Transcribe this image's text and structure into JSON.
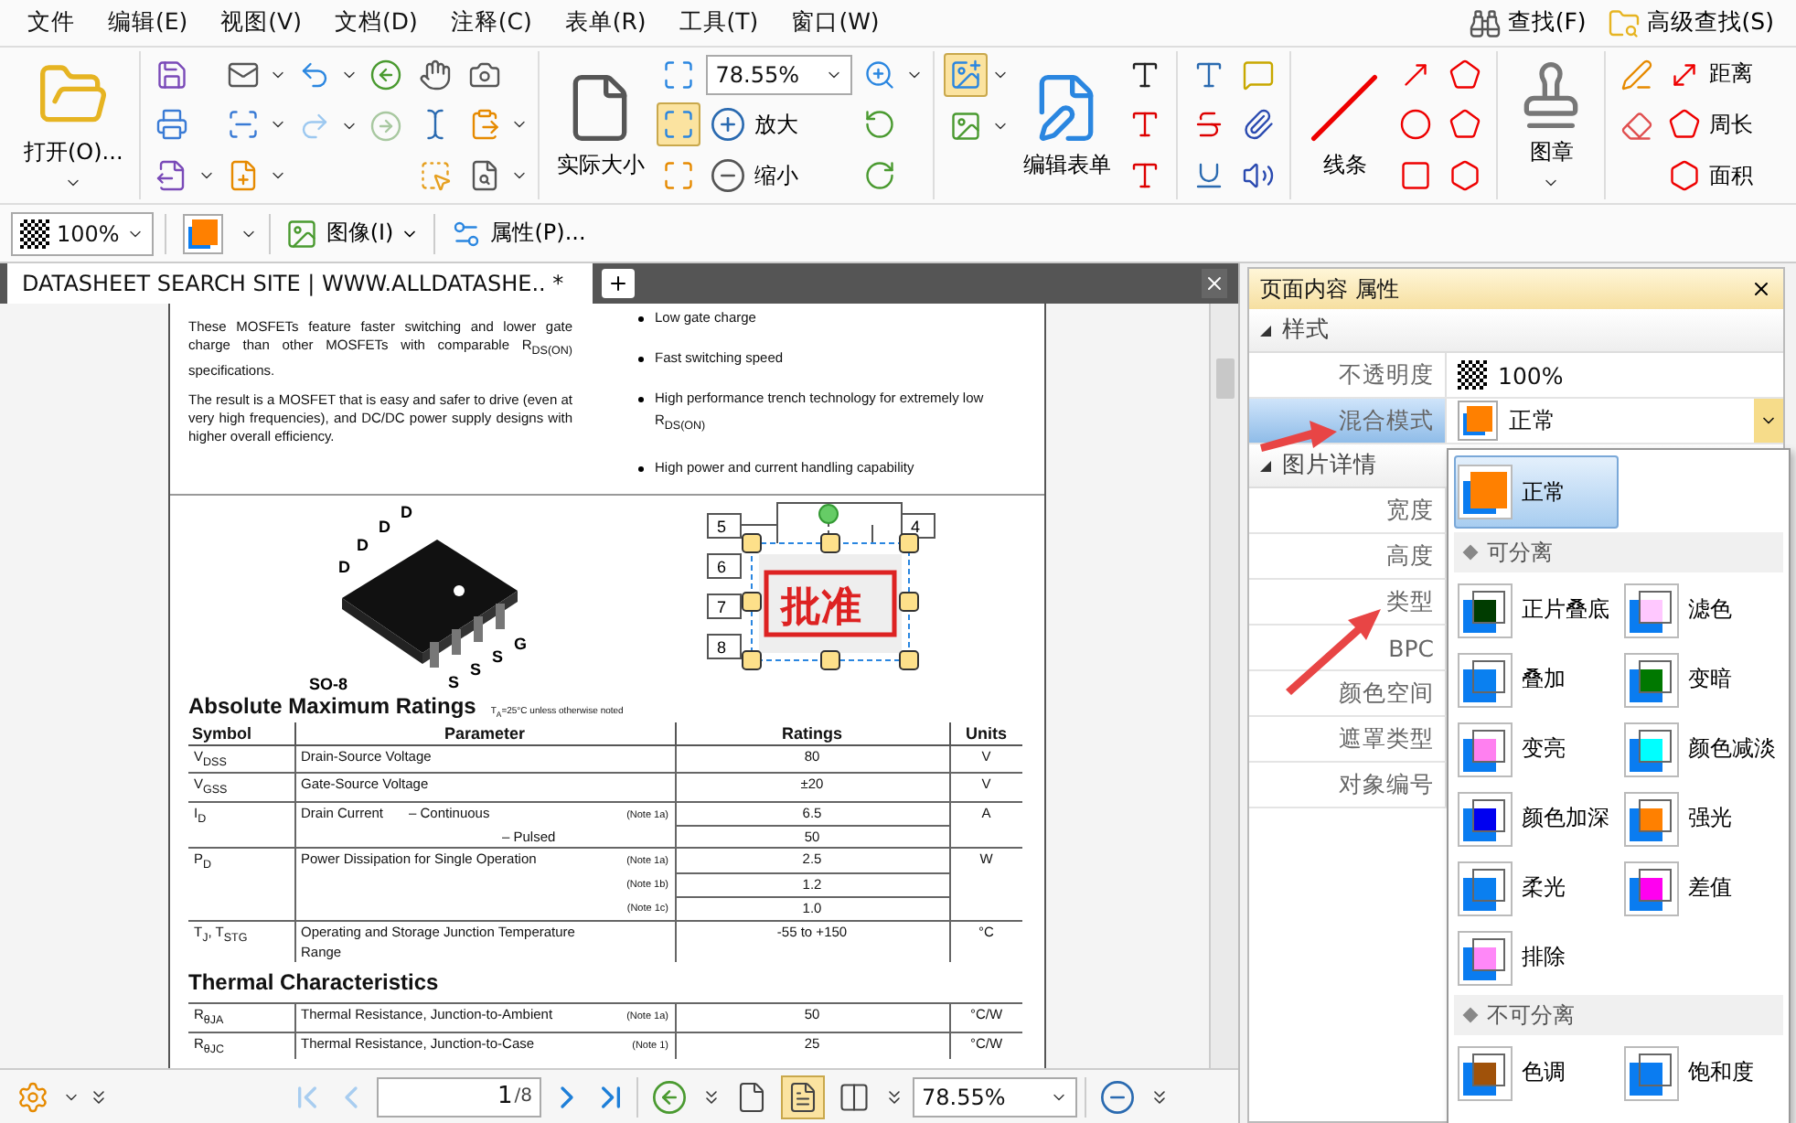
{
  "menu": [
    "文件",
    "编辑(E)",
    "视图(V)",
    "文档(D)",
    "注释(C)",
    "表单(R)",
    "工具(T)",
    "窗口(W)"
  ],
  "search_buttons": [
    "查找(F)",
    "高级查找(S)"
  ],
  "toolbar": {
    "open": "打开(O)...",
    "actual_size": "实际大小",
    "zoom_value": "78.55%",
    "zoom_in": "放大",
    "zoom_out": "缩小",
    "edit_form": "编辑表单",
    "line": "线条",
    "stamp": "图章",
    "distance": "距离",
    "perimeter": "周长",
    "area": "面积",
    "fit_page_selected": true,
    "image_tool_selected": true
  },
  "format_bar": {
    "opacity": "100%",
    "image": "图像(I)",
    "properties": "属性(P)..."
  },
  "tab": {
    "title": "DATASHEET SEARCH SITE | WWW.ALLDATASHE.. *",
    "selected": true
  },
  "document": {
    "description": [
      "These MOSFETs feature faster switching and lower gate charge than other MOSFETs with comparable R$_{DS(ON)}$ specifications.",
      "The result is a MOSFET that is easy and safer to drive (even at very high frequencies), and DC/DC power supply designs with higher overall efficiency."
    ],
    "features": [
      "Low gate charge",
      "Fast switching speed",
      "High performance trench technology for extremely low R$_{DS(ON)}$",
      "High power and current handling capability"
    ],
    "package": {
      "name": "SO-8",
      "pins": [
        "D",
        "D",
        "D",
        "D",
        "G",
        "S",
        "S",
        "S"
      ]
    },
    "pinout": {
      "pins": [
        "5",
        "4",
        "6",
        "7",
        "8"
      ],
      "stamp": "批准",
      "stamp_selected": true
    },
    "ratings": {
      "title": "Absolute Maximum Ratings",
      "note": "T$_{A}$=25°C unless otherwise noted",
      "columns": [
        "Symbol",
        "Parameter",
        "Ratings",
        "Units"
      ],
      "rows": [
        {
          "symbol": "V$_{DSS}$",
          "parameter": "Drain-Source Voltage",
          "lines": [
            {
              "value": "80"
            }
          ],
          "unit": "V"
        },
        {
          "symbol": "V$_{GSS}$",
          "parameter": "Gate-Source Voltage",
          "lines": [
            {
              "value": "±20"
            }
          ],
          "unit": "V"
        },
        {
          "symbol": "I$_{D}$",
          "parameter": "Drain Current",
          "lines": [
            {
              "label": "– Continuous",
              "note": "(Note 1a)",
              "value": "6.5"
            },
            {
              "label": "– Pulsed",
              "value": "50"
            }
          ],
          "unit": "A"
        },
        {
          "symbol": "P$_{D}$",
          "parameter": "Power Dissipation for Single Operation",
          "lines": [
            {
              "note": "(Note 1a)",
              "value": "2.5"
            },
            {
              "note": "(Note 1b)",
              "value": "1.2"
            },
            {
              "note": "(Note 1c)",
              "value": "1.0"
            }
          ],
          "unit": "W"
        },
        {
          "symbol": "T$_{J}$, T$_{STG}$",
          "parameter": "Operating and Storage Junction Temperature Range",
          "lines": [
            {
              "value": "-55 to +150"
            }
          ],
          "unit": "°C"
        }
      ]
    },
    "thermal": {
      "title": "Thermal Characteristics",
      "rows": [
        {
          "symbol": "R$_{θJA}$",
          "parameter": "Thermal Resistance, Junction-to-Ambient",
          "lines": [
            {
              "note": "(Note 1a)",
              "value": "50"
            }
          ],
          "unit": "°C/W"
        },
        {
          "symbol": "R$_{θJC}$",
          "parameter": "Thermal Resistance, Junction-to-Case",
          "lines": [
            {
              "note": "(Note 1)",
              "value": "25"
            }
          ],
          "unit": "°C/W"
        }
      ]
    }
  },
  "navigation": {
    "buttons": [
      {
        "kind": "first",
        "disabled": true
      },
      {
        "kind": "prev",
        "disabled": true
      },
      {
        "kind": "next",
        "disabled": false
      },
      {
        "kind": "last",
        "disabled": false
      }
    ],
    "page": "1",
    "total": "/8",
    "zoom": "78.55%",
    "layouts": [
      {
        "kind": "single",
        "selected": false
      },
      {
        "kind": "continuous",
        "selected": true
      },
      {
        "kind": "facing",
        "selected": false
      }
    ]
  },
  "properties_panel": {
    "title": "页面内容 属性",
    "sections": [
      {
        "title": "样式",
        "expanded": true,
        "rows": [
          {
            "label": "不透明度",
            "kind": "opacity",
            "value": "100%",
            "selected": false
          },
          {
            "label": "混合模式",
            "kind": "blend",
            "value": "正常",
            "selected": true
          }
        ]
      },
      {
        "title": "图片详情",
        "expanded": true,
        "rows": [
          {
            "label": "宽度",
            "selected": false
          },
          {
            "label": "高度",
            "selected": false
          },
          {
            "label": "类型",
            "selected": false
          },
          {
            "label": "BPC",
            "selected": false
          },
          {
            "label": "颜色空间",
            "selected": false
          },
          {
            "label": "遮罩类型",
            "selected": false
          },
          {
            "label": "对象编号",
            "selected": false
          }
        ]
      }
    ]
  },
  "blend_menu": {
    "current": {
      "label": "正常",
      "color": "#ff8000",
      "selected": true
    },
    "groups": [
      {
        "title": "可分离",
        "items": [
          {
            "label": "正片叠底",
            "color": "#003c00",
            "selected": false
          },
          {
            "label": "滤色",
            "color": "#ffc8ff",
            "selected": false
          },
          {
            "label": "叠加",
            "color": "#0a80f0",
            "selected": false
          },
          {
            "label": "变暗",
            "color": "#007800",
            "selected": false
          },
          {
            "label": "变亮",
            "color": "#ff80f0",
            "selected": false
          },
          {
            "label": "颜色减淡",
            "color": "#00ffff",
            "selected": false
          },
          {
            "label": "颜色加深",
            "color": "#0000f0",
            "selected": false
          },
          {
            "label": "强光",
            "color": "#ff8000",
            "selected": false
          },
          {
            "label": "柔光",
            "color": "#0a7ff0",
            "selected": false
          },
          {
            "label": "差值",
            "color": "#ff00f0",
            "selected": false
          },
          {
            "label": "排除",
            "color": "#ff88f8",
            "selected": false
          }
        ]
      },
      {
        "title": "不可分离",
        "items": [
          {
            "label": "色调",
            "color": "#a0520a",
            "selected": false
          },
          {
            "label": "饱和度",
            "color": "#0a7cf1",
            "selected": false
          }
        ]
      }
    ]
  }
}
